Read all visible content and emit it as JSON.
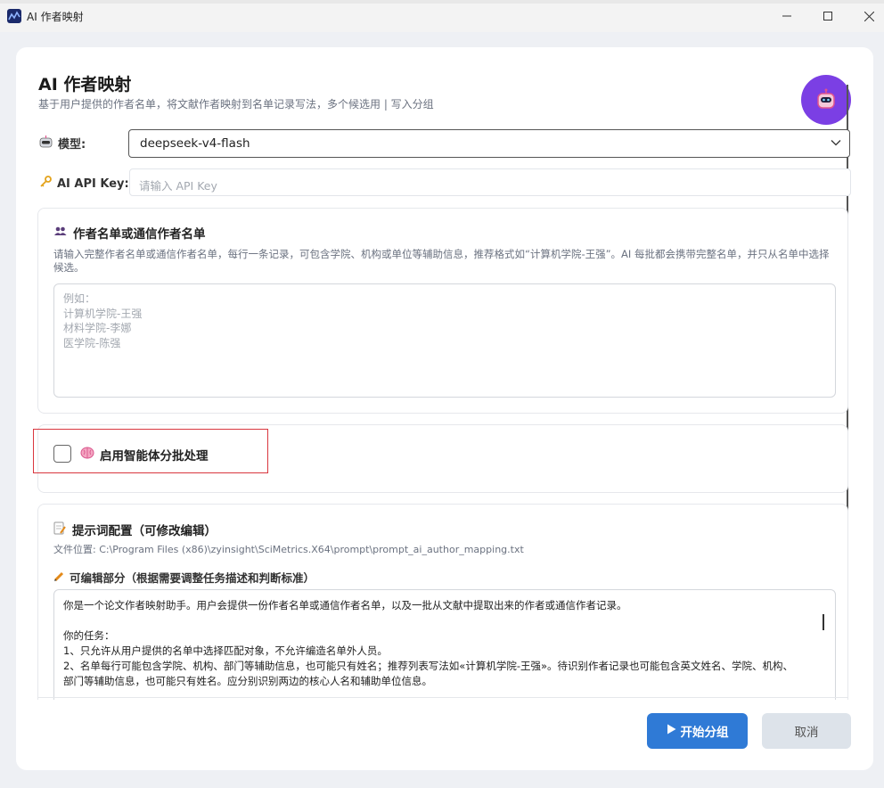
{
  "window": {
    "title": "AI 作者映射"
  },
  "header": {
    "title": "AI 作者映射",
    "subtitle": "基于用户提供的作者名单，将文献作者映射到名单记录写法，多个候选用 | 写入分组"
  },
  "model": {
    "label": "模型:",
    "value": "deepseek-v4-flash"
  },
  "api_key": {
    "label": "AI API Key:",
    "placeholder": "请输入 API Key"
  },
  "author_list": {
    "title": "作者名单或通信作者名单",
    "description": "请输入完整作者名单或通信作者名单，每行一条记录，可包含学院、机构或单位等辅助信息，推荐格式如“计算机学院-王强”。AI 每批都会携带完整名单，并只从名单中选择候选。",
    "placeholder_lines": [
      "例如：",
      "计算机学院-王强",
      "材料学院-李娜",
      "医学院-陈强"
    ]
  },
  "agent": {
    "label": "启用智能体分批处理",
    "checked": false
  },
  "prompt_config": {
    "title": "提示词配置（可修改编辑）",
    "file_path": "文件位置: C:\\Program Files (x86)\\zyinsight\\SciMetrics.X64\\prompt\\prompt_ai_author_mapping.txt",
    "editable_label": "可编辑部分（根据需要调整任务描述和判断标准）",
    "content_lines": [
      "你是一个论文作者映射助手。用户会提供一份作者名单或通信作者名单，以及一批从文献中提取出来的作者或通信作者记录。",
      "",
      "你的任务：",
      "1、只允许从用户提供的名单中选择匹配对象，不允许编造名单外人员。",
      "2、名单每行可能包含学院、机构、部门等辅助信息，也可能只有姓名；推荐列表写法如«计算机学院-王强»。待识别作者记录也可能包含英文姓名、学院、机构、",
      "部门等辅助信息，也可能只有姓名。应分别识别两边的核心人名和辅助单位信息。"
    ]
  },
  "buttons": {
    "start": "开始分组",
    "cancel": "取消"
  },
  "colors": {
    "primary": "#2f7ad6",
    "avatar_bg": "#7b3fe4",
    "highlight_border": "#d9363e"
  }
}
